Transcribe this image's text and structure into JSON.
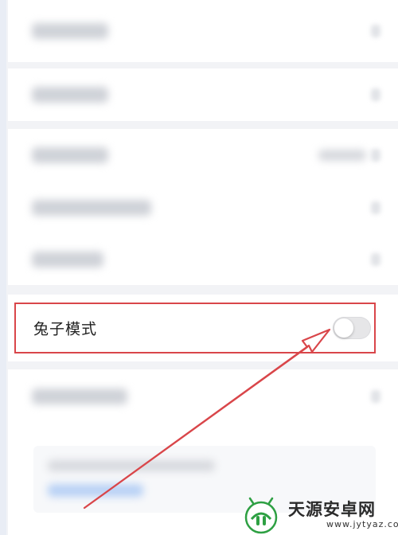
{
  "settings": {
    "rabbit_mode": {
      "label": "兔子模式",
      "enabled": false
    }
  },
  "colors": {
    "highlight_border": "#d9464a",
    "arrow": "#d9464a",
    "toggle_off": "#e6e6e8",
    "watermark_green": "#2ea043"
  },
  "watermark": {
    "name": "天源安卓网",
    "url": "www.jytyaz.com"
  }
}
